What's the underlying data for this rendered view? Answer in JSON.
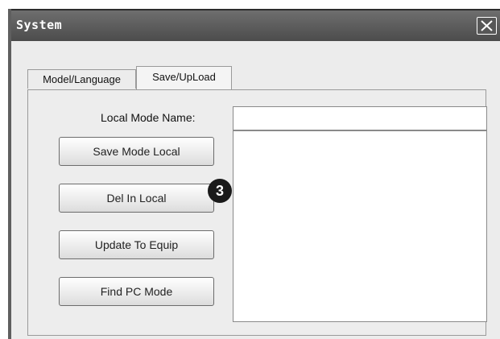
{
  "window": {
    "title": "System",
    "close_icon": "close-icon"
  },
  "tabs": [
    {
      "label": "Model/Language",
      "active": false
    },
    {
      "label": "Save/UpLoad",
      "active": true
    }
  ],
  "form": {
    "local_mode_name_label": "Local Mode Name:",
    "local_mode_name_value": "",
    "buttons": {
      "save_mode_local": "Save Mode Local",
      "del_in_local": "Del In Local",
      "update_to_equip": "Update To Equip",
      "find_pc_mode": "Find PC Mode"
    },
    "list_items": []
  },
  "callout": {
    "number": "3"
  },
  "colors": {
    "titlebar": "#5a5a5a",
    "window_bg": "#ececec",
    "marker": "#1a1a1a"
  }
}
